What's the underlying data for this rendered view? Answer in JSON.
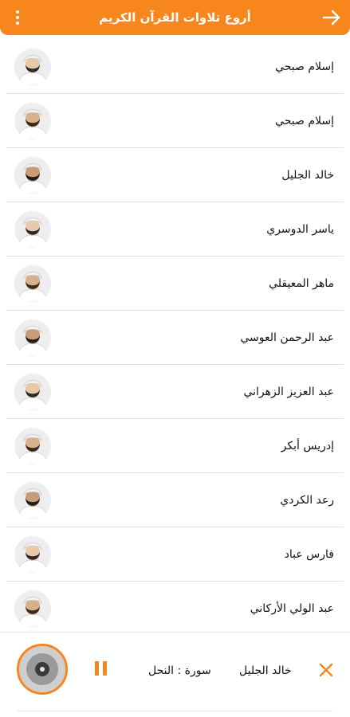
{
  "appbar": {
    "title": "أروع تلاوات القرآن الكريم",
    "back_icon": "arrow-right-icon",
    "menu_icon": "more-vertical-icon",
    "background": "#f7861c"
  },
  "reciters": [
    {
      "name": "إسلام صبحي"
    },
    {
      "name": "إسلام صبحي"
    },
    {
      "name": "خالد الجليل"
    },
    {
      "name": "ياسر الدوسري"
    },
    {
      "name": "ماهر المعيقلي"
    },
    {
      "name": "عبد الرحمن العوسي"
    },
    {
      "name": "عبد العزيز الزهراني"
    },
    {
      "name": "إدريس أبكر"
    },
    {
      "name": "رعد الكردي"
    },
    {
      "name": "فارس عباد"
    },
    {
      "name": "عبد الولي الأركاني"
    }
  ],
  "player": {
    "reciter": "خالد الجليل",
    "surah": "سورة : النحل",
    "state": "playing",
    "pause_icon": "pause-icon",
    "close_icon": "close-icon",
    "accent": "#f7861c"
  }
}
